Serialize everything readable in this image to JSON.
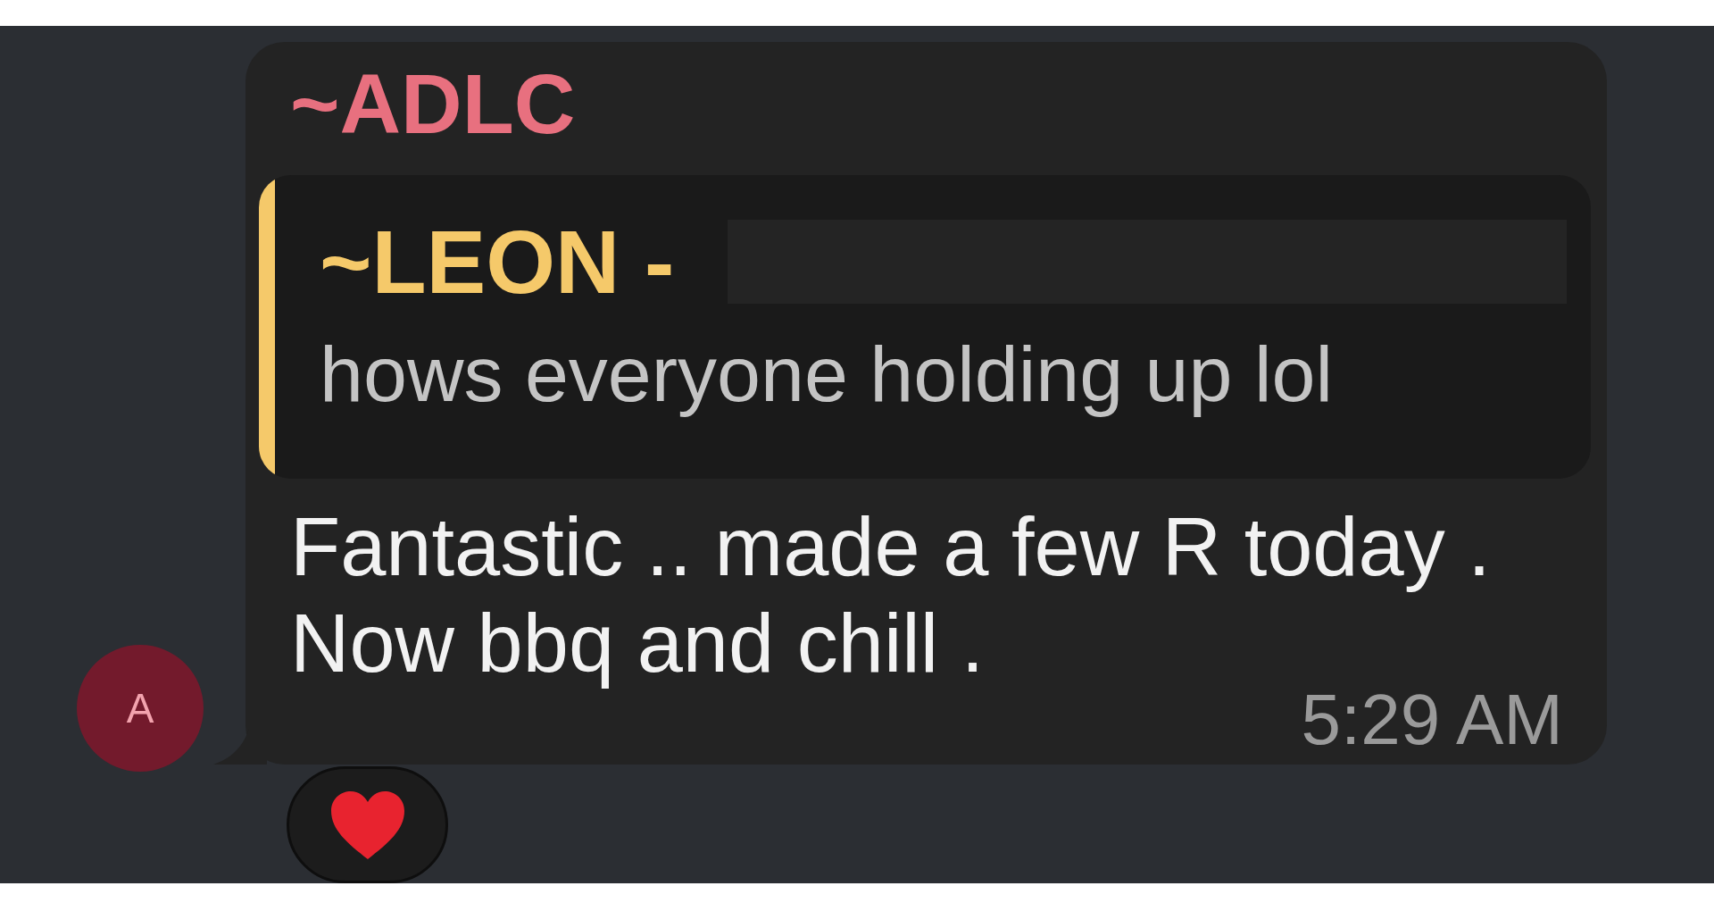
{
  "message": {
    "sender": "~ADLC",
    "avatar": {
      "initial": "A"
    },
    "reply": {
      "sender": "~LEON -",
      "redacted": true,
      "text": "hows everyone holding up lol"
    },
    "text": "Fantastic .. made a few R today . Now bbq and chill .",
    "time": "5:29 AM",
    "reactions": [
      {
        "kind": "heart"
      }
    ]
  }
}
